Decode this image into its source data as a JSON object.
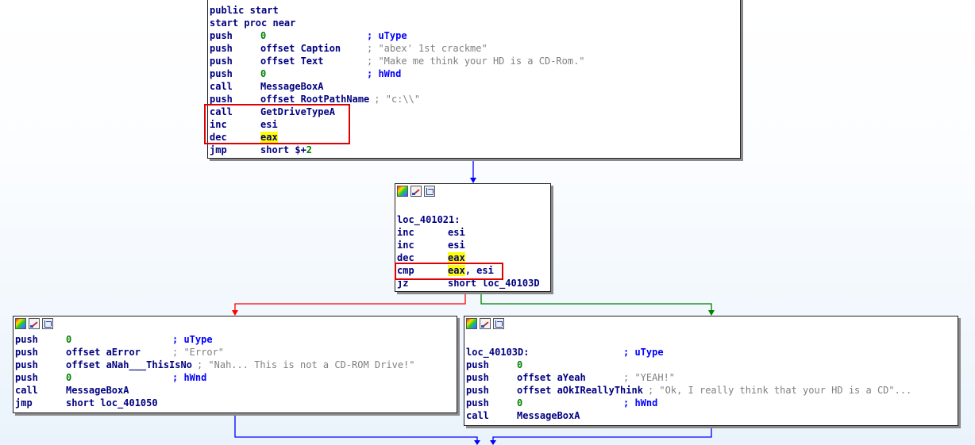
{
  "nodes": {
    "start": {
      "lines": [
        {
          "label": "public start"
        },
        {
          "label": "start proc near"
        },
        {
          "mnem": "push",
          "num": "0",
          "comment": "; uType",
          "comment_style": "blue"
        },
        {
          "mnem": "push",
          "op": "offset Caption",
          "comment": "; \"abex' 1st crackme\""
        },
        {
          "mnem": "push",
          "op": "offset Text",
          "comment": "; \"Make me think your HD is a CD-Rom.\""
        },
        {
          "mnem": "push",
          "num": "0",
          "comment": "; hWnd",
          "comment_style": "blue"
        },
        {
          "mnem": "call",
          "sym": "MessageBoxA"
        },
        {
          "mnem": "push",
          "op": "offset RootPathName",
          "comment": "; \"c:\\\\\""
        },
        {
          "mnem": "call",
          "sym": "GetDriveTypeA"
        },
        {
          "mnem": "inc",
          "op": "esi"
        },
        {
          "mnem": "dec",
          "op_highlight": "eax"
        },
        {
          "mnem": "jmp",
          "op": "short $+",
          "num_tail": "2"
        }
      ]
    },
    "loc_401021": {
      "lines": [
        {
          "label": ""
        },
        {
          "label": "loc_401021:"
        },
        {
          "mnem": "inc",
          "op": "esi"
        },
        {
          "mnem": "inc",
          "op": "esi"
        },
        {
          "mnem": "dec",
          "op_highlight": "eax"
        },
        {
          "mnem": "cmp",
          "op_highlight": "eax",
          "op_tail": ", esi"
        },
        {
          "mnem": "jz",
          "op": "short loc_40103D"
        }
      ]
    },
    "error_block": {
      "lines": [
        {
          "mnem": "push",
          "num": "0",
          "comment": "; uType",
          "comment_style": "blue"
        },
        {
          "mnem": "push",
          "op": "offset aError",
          "comment": "; \"Error\""
        },
        {
          "mnem": "push",
          "op": "offset aNah___ThisIsNo",
          "comment": "; \"Nah... This is not a CD-ROM Drive!\""
        },
        {
          "mnem": "push",
          "num": "0",
          "comment": "; hWnd",
          "comment_style": "blue"
        },
        {
          "mnem": "call",
          "sym": "MessageBoxA"
        },
        {
          "mnem": "jmp",
          "op": "short loc_401050"
        }
      ]
    },
    "loc_40103D": {
      "lines": [
        {
          "label": ""
        },
        {
          "label": "loc_40103D:",
          "comment": "; uType",
          "comment_style": "blue"
        },
        {
          "mnem": "push",
          "num": "0"
        },
        {
          "mnem": "push",
          "op": "offset aYeah",
          "comment": "; \"YEAH!\""
        },
        {
          "mnem": "push",
          "op": "offset aOkIReallyThink",
          "comment": "; \"Ok, I really think that your HD is a CD\"..."
        },
        {
          "mnem": "push",
          "num": "0",
          "comment": "; hWnd",
          "comment_style": "blue"
        },
        {
          "mnem": "call",
          "sym": "MessageBoxA"
        }
      ]
    }
  },
  "edge_colors": {
    "normal": "#0000ff",
    "false_branch": "#ff0000",
    "true_branch": "#008000"
  },
  "highlight_color": "#ffff00",
  "annotation_box_color": "#e00000"
}
